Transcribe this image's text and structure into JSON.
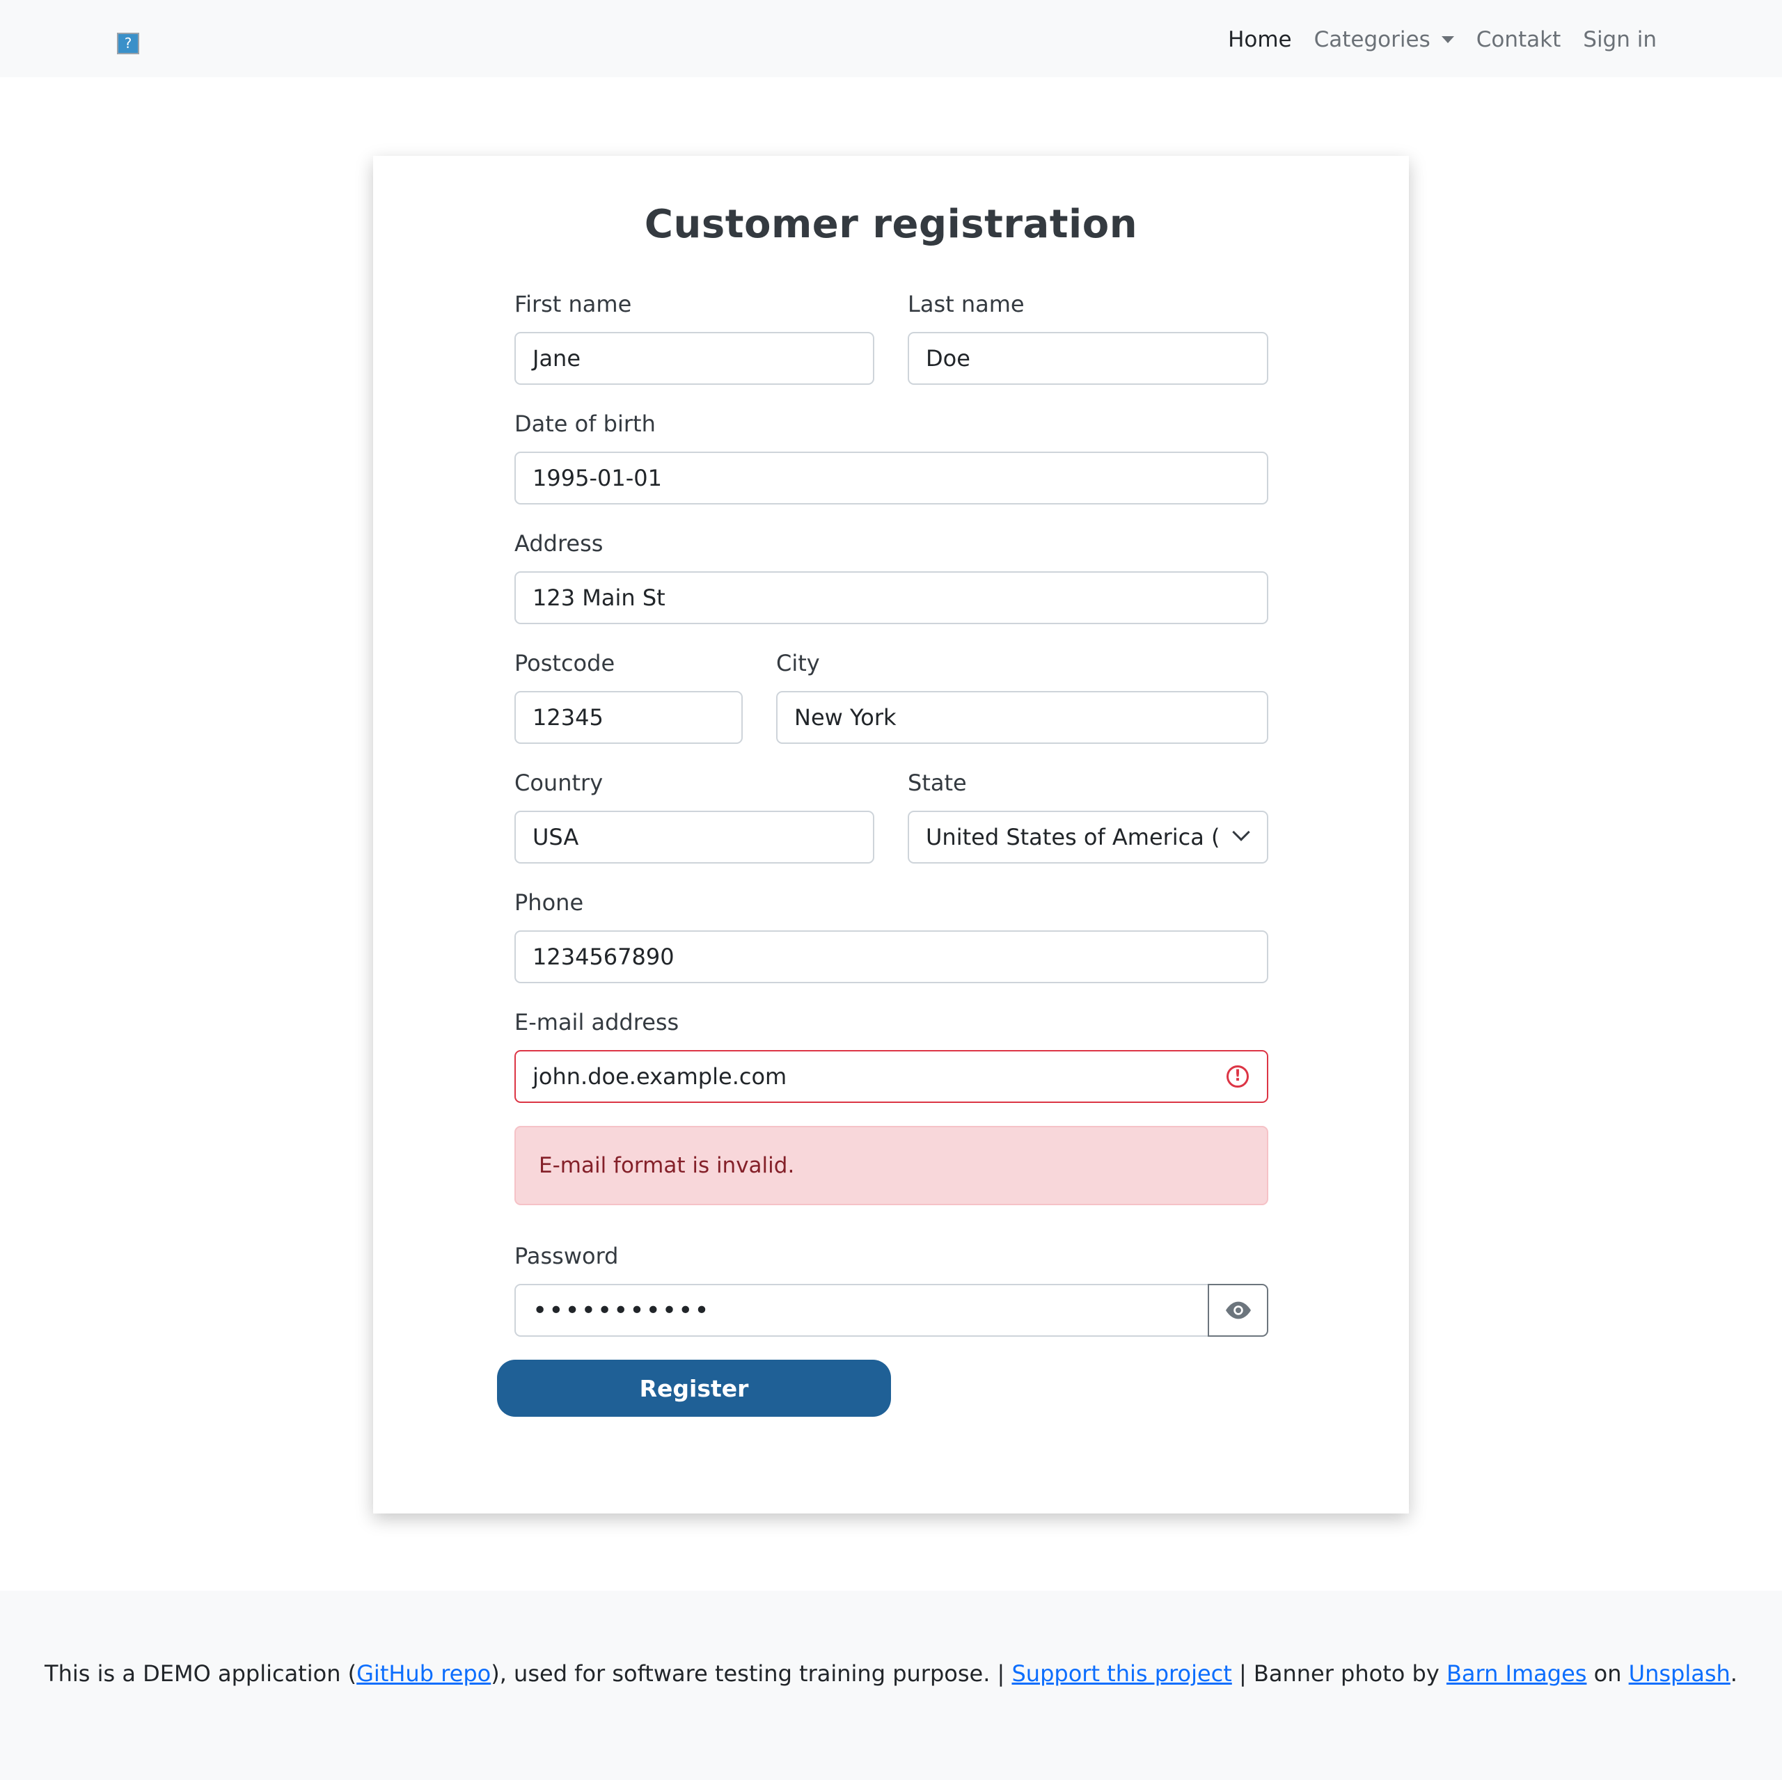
{
  "nav": {
    "logo_glyph": "?",
    "links": [
      "Home",
      "Categories",
      "Contakt",
      "Sign in"
    ]
  },
  "form": {
    "title": "Customer registration",
    "first_name": {
      "label": "First name",
      "value": "Jane"
    },
    "last_name": {
      "label": "Last name",
      "value": "Doe"
    },
    "dob": {
      "label": "Date of birth",
      "value": "1995-01-01"
    },
    "address": {
      "label": "Address",
      "value": "123 Main St"
    },
    "postcode": {
      "label": "Postcode",
      "value": "12345"
    },
    "city": {
      "label": "City",
      "value": "New York"
    },
    "country": {
      "label": "Country",
      "value": "USA"
    },
    "state": {
      "label": "State",
      "value": "United States of America (the)"
    },
    "phone": {
      "label": "Phone",
      "value": "1234567890"
    },
    "email": {
      "label": "E-mail address",
      "value": "john.doe.example.com",
      "error": "E-mail format is invalid."
    },
    "password": {
      "label": "Password",
      "value": "•••••••••••"
    },
    "register_label": "Register"
  },
  "footer": {
    "prefix": "This is a DEMO application (",
    "github_link": "GitHub repo",
    "middle": "), used for software testing training purpose. | ",
    "support_link": "Support this project",
    "photo_text": " | Banner photo by ",
    "barn_link": "Barn Images",
    "on_text": " on ",
    "unsplash_link": "Unsplash",
    "end": "."
  },
  "colors": {
    "primary": "#1f6096",
    "danger": "#dc3545",
    "alert_bg": "#f8d7da",
    "link": "#0d6efd"
  }
}
